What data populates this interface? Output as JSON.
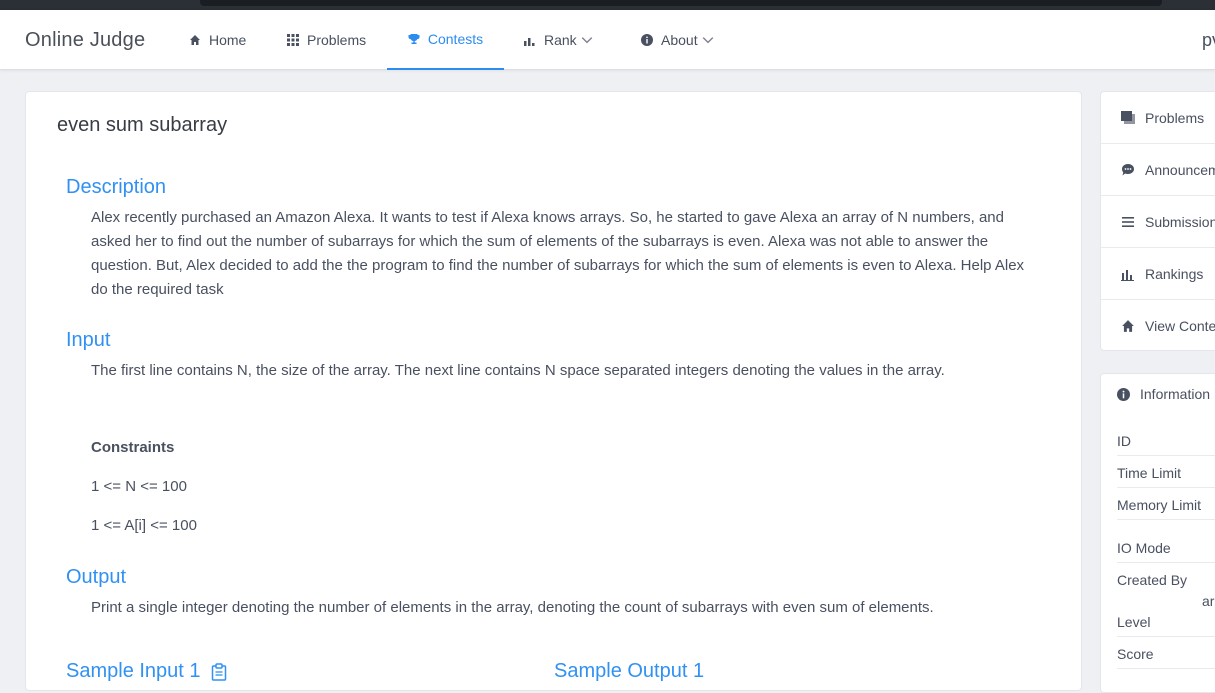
{
  "nav": {
    "brand": "Online Judge",
    "items": [
      {
        "label": "Home",
        "icon": "home-icon"
      },
      {
        "label": "Problems",
        "icon": "grid-icon"
      },
      {
        "label": "Contests",
        "icon": "trophy-icon",
        "active": true
      },
      {
        "label": "Rank",
        "icon": "bar-chart-icon",
        "dropdown": true
      },
      {
        "label": "About",
        "icon": "info-icon",
        "dropdown": true
      }
    ],
    "user": "pv"
  },
  "problem": {
    "title": "even sum subarray",
    "description_title": "Description",
    "description_text": "Alex recently purchased an Amazon Alexa. It wants to test if Alexa knows arrays. So, he started to gave Alexa an array of N numbers, and asked her to find out the number of subarrays for which the sum of elements of the subarrays is even. Alexa was not able to answer the question. But, Alex decided to add the the program to find the number of subarrays for which the sum of elements is even to Alexa. Help Alex do the required task",
    "input_title": "Input",
    "input_text": "The first line contains N, the size of the array. The next line contains N space separated integers denoting the values in the array.",
    "constraints_title": "Constraints",
    "constraints": [
      "1 <= N <= 100",
      "1 <= A[i] <= 100"
    ],
    "output_title": "Output",
    "output_text": "Print a single integer denoting the number of elements in the array, denoting the count of subarrays with even sum of elements.",
    "sample_input_title": "Sample Input 1",
    "sample_output_title": "Sample Output 1"
  },
  "sidebar": {
    "menu": [
      {
        "label": "Problems",
        "icon": "problems-icon"
      },
      {
        "label": "Announcements",
        "icon": "chat-icon"
      },
      {
        "label": "Submissions",
        "icon": "list-icon"
      },
      {
        "label": "Rankings",
        "icon": "bar-chart-icon"
      },
      {
        "label": "View Contest",
        "icon": "home-icon"
      }
    ],
    "info_title": "Information",
    "info_rows": [
      "ID",
      "Time Limit",
      "Memory Limit",
      "IO Mode",
      "Created By",
      "Level",
      "Score"
    ],
    "created_by_value": "ar"
  },
  "colors": {
    "accent": "#2d8cf0",
    "section": "#3091f2"
  }
}
